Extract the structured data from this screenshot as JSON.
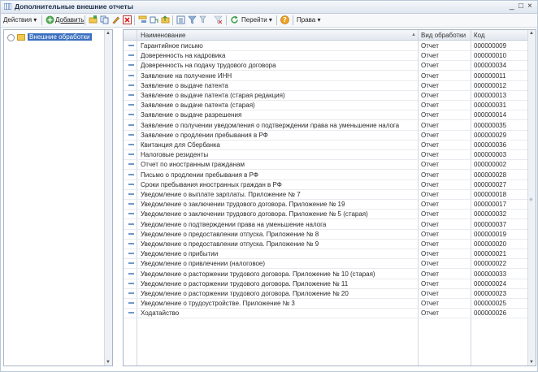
{
  "window": {
    "title": "Дополнительные внешние отчеты",
    "controls": [
      "_",
      "□",
      "×"
    ]
  },
  "toolbar": {
    "actions_label": "Действия ▾",
    "add_label": "Добавить",
    "goto_label": "Перейти ▾",
    "rights_label": "Права ▾"
  },
  "tree": {
    "root_label": "Внешние обработки"
  },
  "table": {
    "columns": [
      "Наименование",
      "Вид обработки",
      "Код"
    ],
    "rows": [
      {
        "name": "Гарантийное письмо",
        "type": "Отчет",
        "code": "000000009"
      },
      {
        "name": "Доверенность на кадровика",
        "type": "Отчет",
        "code": "000000010"
      },
      {
        "name": "Доверенность на подачу трудового договора",
        "type": "Отчет",
        "code": "000000034"
      },
      {
        "name": "Заявление на получение ИНН",
        "type": "Отчет",
        "code": "000000011"
      },
      {
        "name": "Заявление о выдаче патента",
        "type": "Отчет",
        "code": "000000012"
      },
      {
        "name": "Заявление о выдаче патента (старая редакция)",
        "type": "Отчет",
        "code": "000000013"
      },
      {
        "name": "Заявление о выдаче патента (старая)",
        "type": "Отчет",
        "code": "000000031"
      },
      {
        "name": "Заявление о выдаче разрешения",
        "type": "Отчет",
        "code": "000000014"
      },
      {
        "name": "Заявление о получении уведомления о подтверждении права на уменьшение налога",
        "type": "Отчет",
        "code": "000000035"
      },
      {
        "name": "Заявление о продлении пребывания в РФ",
        "type": "Отчет",
        "code": "000000029"
      },
      {
        "name": "Квитанция для Сбербанка",
        "type": "Отчет",
        "code": "000000036"
      },
      {
        "name": "Налоговые резиденты",
        "type": "Отчет",
        "code": "000000003"
      },
      {
        "name": "Отчет по иностранным гражданам",
        "type": "Отчет",
        "code": "000000002"
      },
      {
        "name": "Письмо о продлении пребывания в РФ",
        "type": "Отчет",
        "code": "000000028"
      },
      {
        "name": "Сроки пребывания иностранных граждан в РФ",
        "type": "Отчет",
        "code": "000000027"
      },
      {
        "name": "Уведомление о выплате зарплаты. Приложение № 7",
        "type": "Отчет",
        "code": "000000018"
      },
      {
        "name": "Уведомление о заключении трудового договора. Приложение № 19",
        "type": "Отчет",
        "code": "000000017"
      },
      {
        "name": "Уведомление о заключении трудового договора. Приложение № 5 (старая)",
        "type": "Отчет",
        "code": "000000032"
      },
      {
        "name": "Уведомление о подтверждении права на уменьшение налога",
        "type": "Отчет",
        "code": "000000037"
      },
      {
        "name": "Уведомление о предоставлении отпуска. Приложение № 8",
        "type": "Отчет",
        "code": "000000019"
      },
      {
        "name": "Уведомление о предоставлении отпуска. Приложение № 9",
        "type": "Отчет",
        "code": "000000020"
      },
      {
        "name": "Уведомление о прибытии",
        "type": "Отчет",
        "code": "000000021"
      },
      {
        "name": "Уведомление о привлечении (налоговое)",
        "type": "Отчет",
        "code": "000000022"
      },
      {
        "name": "Уведомление о расторжении трудового договора. Приложение № 10 (старая)",
        "type": "Отчет",
        "code": "000000033"
      },
      {
        "name": "Уведомление о расторжении трудового договора. Приложение № 11",
        "type": "Отчет",
        "code": "000000024"
      },
      {
        "name": "Уведомление о расторжении трудового договора. Приложение № 20",
        "type": "Отчет",
        "code": "000000023"
      },
      {
        "name": "Уведомление о трудоустройстве. Приложение № 3",
        "type": "Отчет",
        "code": "000000025"
      },
      {
        "name": "Ходатайство",
        "type": "Отчет",
        "code": "000000026"
      }
    ]
  }
}
